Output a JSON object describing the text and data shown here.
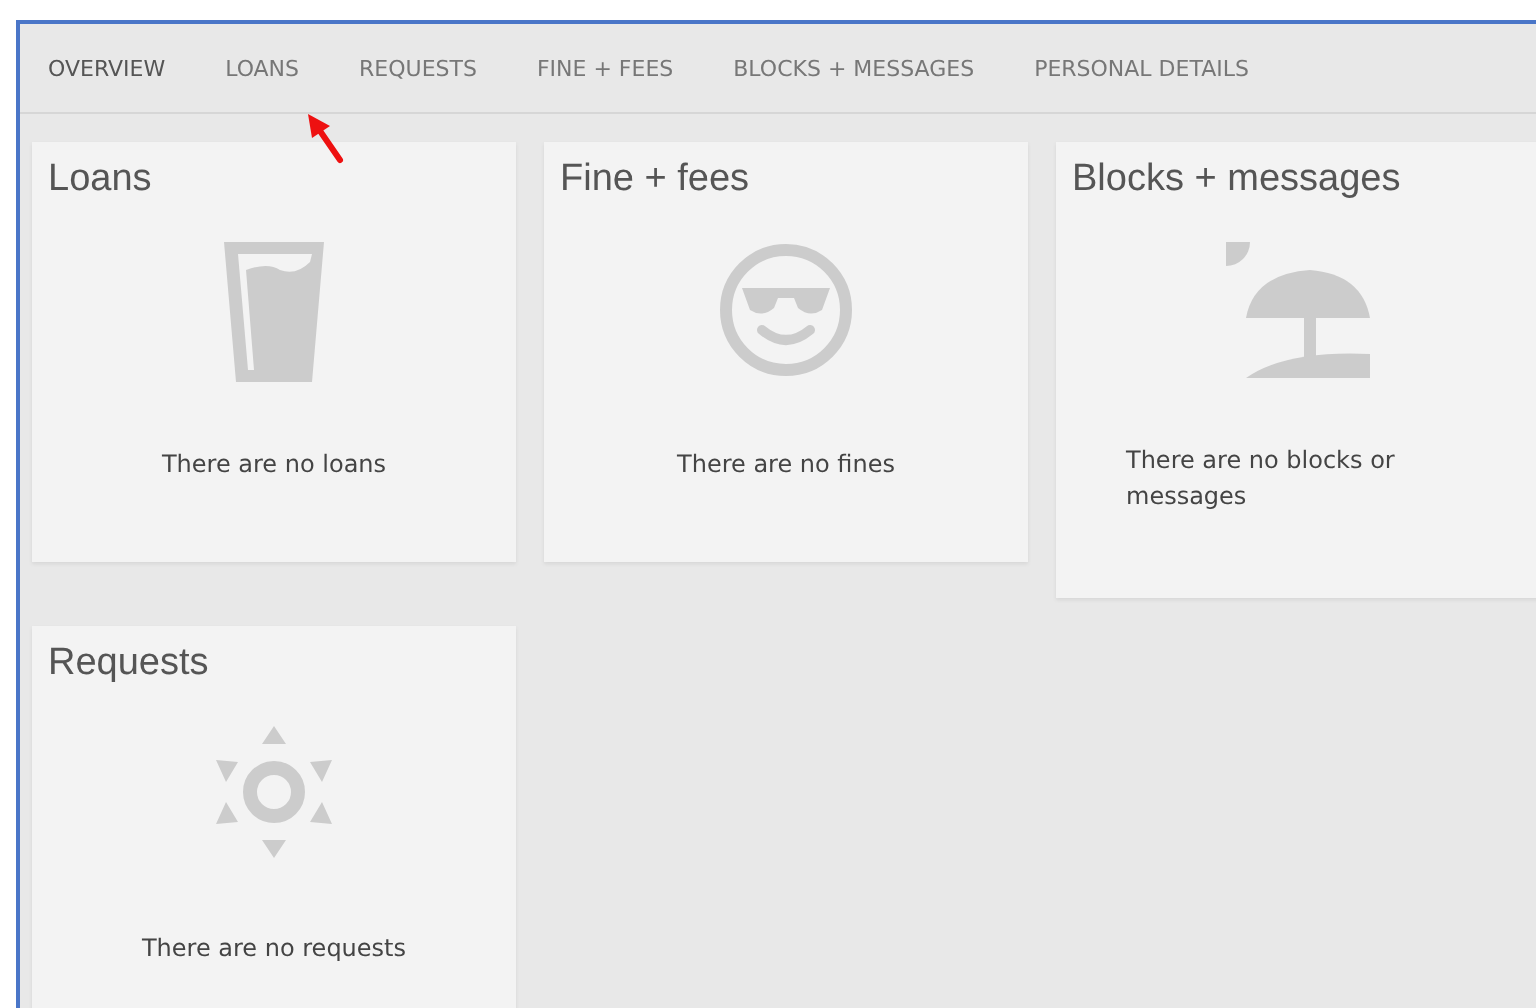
{
  "tabs": [
    {
      "label": "OVERVIEW",
      "selected": true
    },
    {
      "label": "LOANS",
      "selected": false
    },
    {
      "label": "REQUESTS",
      "selected": false
    },
    {
      "label": "FINE + FEES",
      "selected": false
    },
    {
      "label": "BLOCKS + MESSAGES",
      "selected": false
    },
    {
      "label": "PERSONAL DETAILS",
      "selected": false
    }
  ],
  "cards": [
    {
      "title": "Loans",
      "message": "There are no loans"
    },
    {
      "title": "Fine + fees",
      "message": "There are no fines"
    },
    {
      "title": "Blocks + messages",
      "message": "There are no blocks or messages"
    },
    {
      "title": "Requests",
      "message": "There are no requests"
    }
  ]
}
